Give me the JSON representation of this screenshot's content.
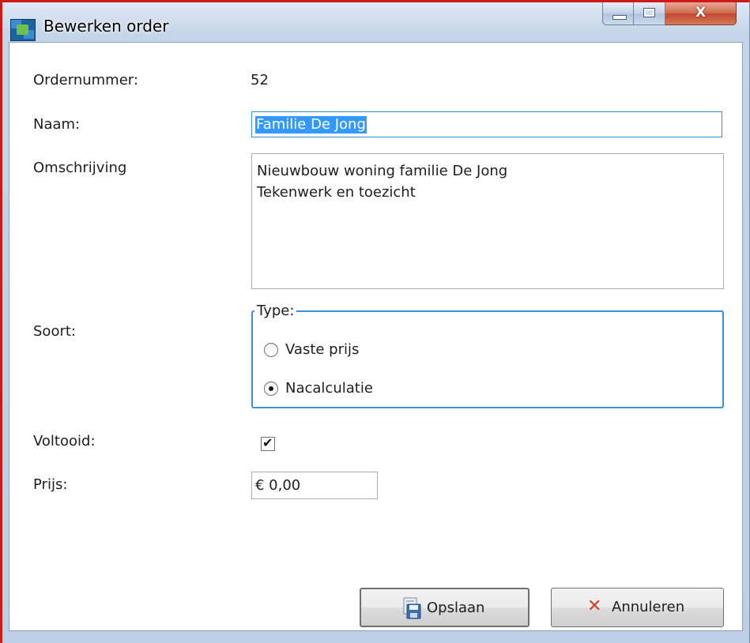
{
  "window": {
    "title": "Bewerken order",
    "icon": "app-icon",
    "caption_icons": [
      "minimize-icon",
      "maximize-icon",
      "close-icon"
    ],
    "close_glyph": "X"
  },
  "form": {
    "ordernummer": {
      "label": "Ordernummer:",
      "value": "52"
    },
    "naam": {
      "label": "Naam:",
      "value": "Familie De Jong"
    },
    "omschrijving": {
      "label": "Omschrijving",
      "value": "Nieuwbouw woning familie De Jong\nTekenwerk en toezicht"
    },
    "soort": {
      "label": "Soort:",
      "group_title": "Type:",
      "options": [
        {
          "label": "Vaste prijs",
          "selected": false
        },
        {
          "label": "Nacalculatie",
          "selected": true
        }
      ]
    },
    "voltooid": {
      "label": "Voltooid:",
      "checked": true
    },
    "prijs": {
      "label": "Prijs:",
      "value": "€ 0,00"
    }
  },
  "buttons": {
    "save": {
      "label": "Opslaan",
      "icon": "save-icon"
    },
    "cancel": {
      "label": "Annuleren",
      "icon": "cancel-x-icon",
      "glyph": "✕"
    }
  },
  "colors": {
    "window_frame_accent": "#cc1a1a",
    "focus_border": "#3a8bd1",
    "selection": "#3399ff",
    "close_button": "#c2472c",
    "cancel_icon": "#d0402a"
  }
}
